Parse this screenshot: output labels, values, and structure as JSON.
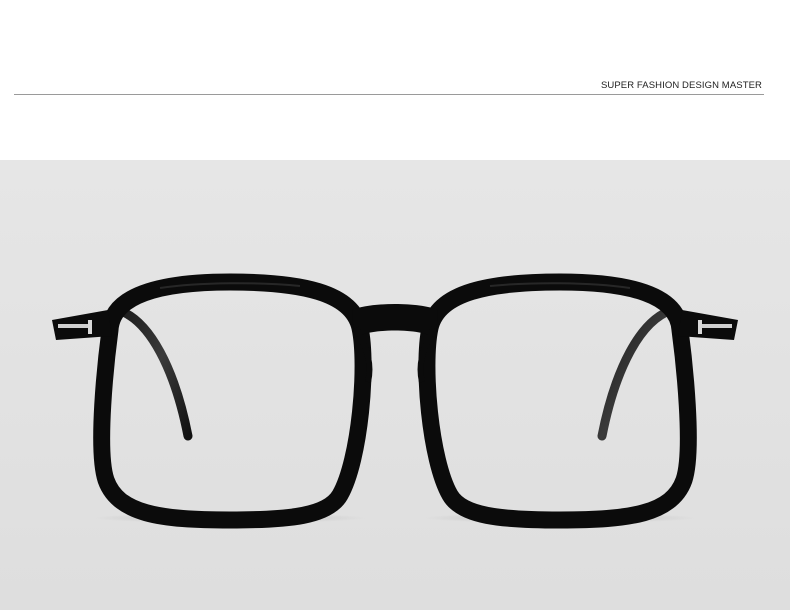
{
  "header": {
    "brand_text": "SUPER FASHION DESIGN MASTER"
  },
  "product": {
    "background_color": "#e3e3e3",
    "frame_color": "#0b0b0b",
    "hinge_color": "#c9c9c9"
  }
}
